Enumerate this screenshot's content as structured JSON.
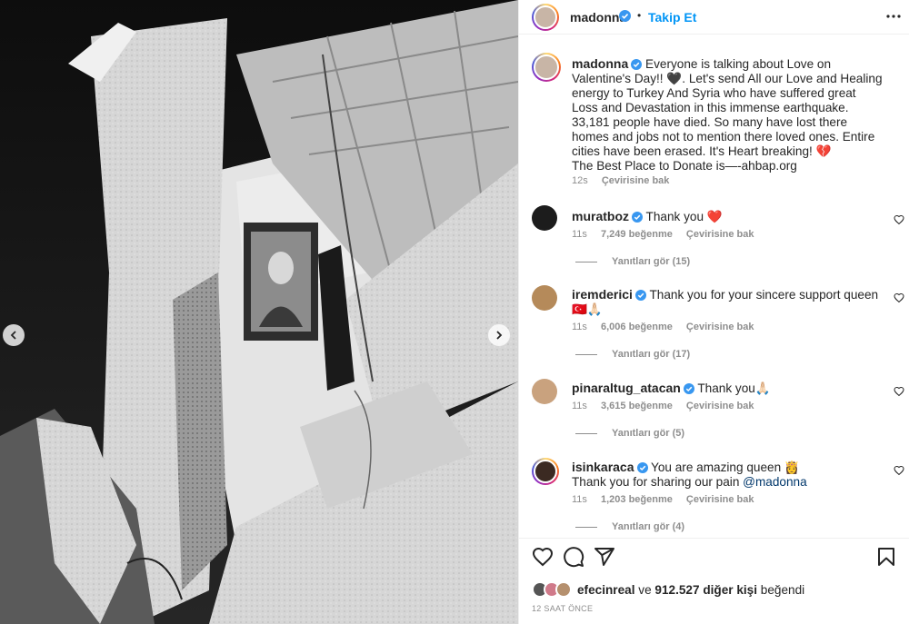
{
  "post": {
    "author": "madonna",
    "follow_label": "Takip Et",
    "dot": "•",
    "caption_lines": [
      "Everyone is talking about Love  on Valentine's Day!! 🖤. Let's send All our Love and Healing  energy to Turkey And Syria who have suffered great Loss and Devastation in this immense earthquake.  33,181 people have died.  So many  have lost there homes and jobs not to mention there loved ones. Entire cities have been erased. It's Heart breaking! 💔",
      "The Best Place to Donate is—-ahbap.org"
    ],
    "caption_time": "12s",
    "translate_label": "Çevirisine bak",
    "posted_time": "12 SAAT ÖNCE",
    "likes": {
      "user": "efecinreal",
      "connector": "ve",
      "others": "912.527 diğer kişi",
      "suffix": "beğendi"
    }
  },
  "comments": [
    {
      "user": "muratboz",
      "text": "Thank you ❤️",
      "time": "11s",
      "likes": "7,249 beğenme",
      "translate": "Çevirisine bak",
      "replies": "Yanıtları gör (15)"
    },
    {
      "user": "iremderici",
      "text": "Thank you for your sincere support queen 🇹🇷🙏🏻",
      "time": "11s",
      "likes": "6,006 beğenme",
      "translate": "Çevirisine bak",
      "replies": "Yanıtları gör (17)"
    },
    {
      "user": "pinaraltug_atacan",
      "text": "Thank you🙏🏻",
      "time": "11s",
      "likes": "3,615 beğenme",
      "translate": "Çevirisine bak",
      "replies": "Yanıtları gör (5)"
    },
    {
      "user": "isinkaraca",
      "text": "You are amazing queen 👸",
      "text2": "Thank you for sharing our pain",
      "mention": "@madonna",
      "time": "11s",
      "likes": "1,203 beğenme",
      "translate": "Çevirisine bak",
      "replies": "Yanıtları gör (4)"
    }
  ],
  "icons": {
    "more": "more-options-icon",
    "like": "heart-icon",
    "comment": "comment-icon",
    "share": "share-icon",
    "save": "bookmark-icon",
    "prev": "chevron-left-icon",
    "next": "chevron-right-icon"
  },
  "colors": {
    "accent": "#0095f6",
    "text": "#262626",
    "muted": "#8e8e8e",
    "verified": "#3897f0",
    "heart": "#ed4956"
  }
}
